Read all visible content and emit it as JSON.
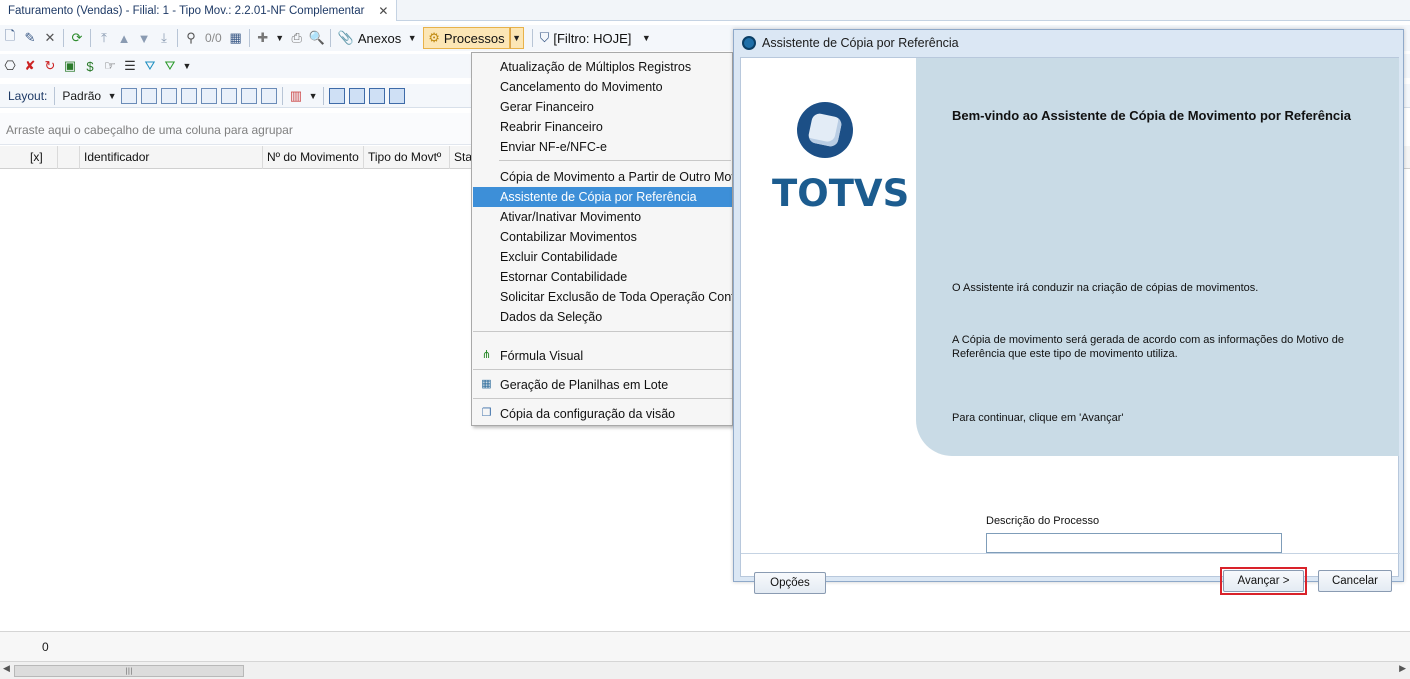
{
  "document_tab": {
    "title": "Faturamento (Vendas) - Filial: 1 - Tipo Mov.: 2.2.01-NF Complementar",
    "close": "✕"
  },
  "toolbar1": {
    "record_counter": "0/0",
    "anexos_label": "Anexos",
    "processos_label": "Processos",
    "filtro_label": "[Filtro: HOJE]"
  },
  "toolbar3": {
    "layout_label": "Layout:",
    "layout_value": "Padrão"
  },
  "grid": {
    "group_hint": "Arraste aqui o cabeçalho de uma coluna para agrupar",
    "columns": [
      "[x]",
      "Identificador",
      "Nº do Movimento",
      "Tipo do Movtº",
      "Sta"
    ],
    "row_count": "0"
  },
  "processos_menu": {
    "items": [
      "Atualização de Múltiplos Registros",
      "Cancelamento do Movimento",
      "Gerar Financeiro",
      "Reabrir Financeiro",
      "Enviar NF-e/NFC-e",
      "Cópia de Movimento a Partir de Outro Movimento",
      "Assistente de Cópia por Referência",
      "Ativar/Inativar Movimento",
      "Contabilizar Movimentos",
      "Excluir Contabilidade",
      "Estornar Contabilidade",
      "Solicitar Exclusão de Toda Operação Contábil",
      "Dados da Seleção",
      "Fórmula Visual",
      "Geração de Planilhas em Lote",
      "Cópia da configuração da visão"
    ],
    "highlighted_index": 6,
    "highlight_color": "#3d8fd8"
  },
  "wizard": {
    "title": "Assistente de Cópia por Referência",
    "logo_text": "TOTVS",
    "heading": "Bem-vindo ao Assistente de Cópia de Movimento por Referência",
    "paragraph1": "O Assistente irá conduzir na criação  de cópias de movimentos.",
    "paragraph2": "A Cópia de movimento será gerada de acordo com as informações do Motivo de Referência que este tipo de movimento utiliza.",
    "paragraph3": "Para continuar, clique em 'Avançar'",
    "description_label": "Descrição do Processo",
    "description_value": "",
    "buttons": {
      "options": "Opções",
      "next": "Avançar >",
      "cancel": "Cancelar"
    },
    "focus_color": "#d9222a"
  }
}
